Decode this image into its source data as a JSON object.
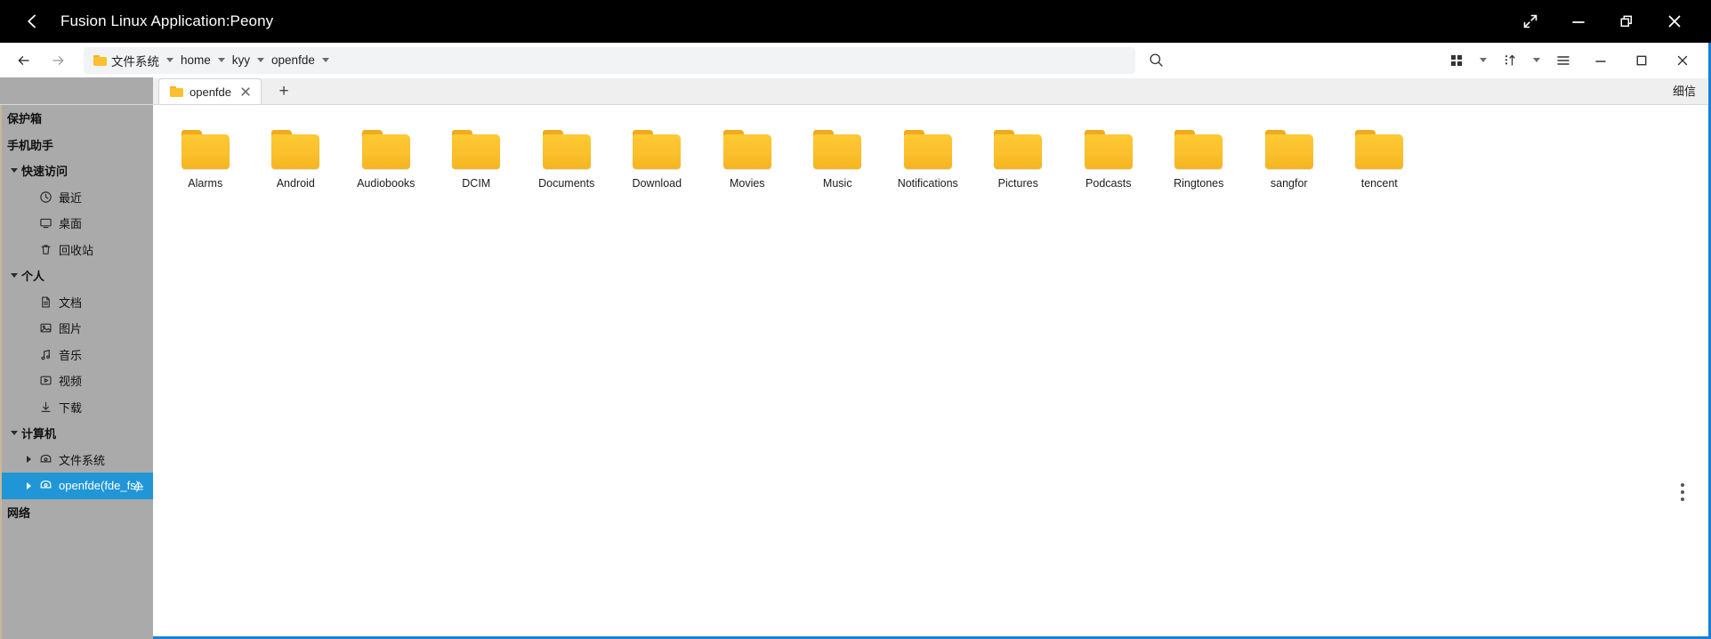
{
  "titlebar": {
    "back_icon": "chevron-left-icon",
    "title": "Fusion Linux Application:Peony",
    "controls": [
      {
        "name": "expand-button",
        "icon": "expand-arrows-icon"
      },
      {
        "name": "minimize-button",
        "icon": "minimize-icon"
      },
      {
        "name": "restore-button",
        "icon": "restore-windows-icon"
      },
      {
        "name": "close-button",
        "icon": "close-x-icon"
      }
    ]
  },
  "toolbar": {
    "back_icon": "arrow-left-icon",
    "forward_icon": "arrow-right-icon",
    "breadcrumbs": [
      {
        "label": "文件系统",
        "has_folder_icon": true
      },
      {
        "label": "home",
        "has_folder_icon": false
      },
      {
        "label": "kyy",
        "has_folder_icon": false
      },
      {
        "label": "openfde",
        "has_folder_icon": false
      }
    ],
    "search_icon": "search-icon",
    "view_icon": "grid-view-icon",
    "sort_icon": "sort-ascending-icon",
    "menu_icon": "hamburger-menu-icon",
    "window_minimize_icon": "minimize-icon",
    "window_maximize_icon": "maximize-icon",
    "window_close_icon": "close-x-icon"
  },
  "tabs": {
    "items": [
      {
        "label": "openfde",
        "close_icon": "close-x-icon",
        "active": true
      }
    ],
    "new_tab_label": "+",
    "right_label": "细信"
  },
  "sidebar": {
    "rows": [
      {
        "label": "保护箱",
        "indent": "ind-sec",
        "bold": true,
        "twisty": "none",
        "icon": "none",
        "selected": false
      },
      {
        "label": "手机助手",
        "indent": "ind-sec",
        "bold": true,
        "twisty": "none",
        "icon": "none",
        "selected": false
      },
      {
        "label": "快速访问",
        "indent": "ind-sec",
        "bold": true,
        "twisty": "down",
        "icon": "none",
        "selected": false
      },
      {
        "label": "最近",
        "indent": "ind-1",
        "bold": false,
        "twisty": "none",
        "icon": "clock-icon",
        "selected": false
      },
      {
        "label": "桌面",
        "indent": "ind-1",
        "bold": false,
        "twisty": "none",
        "icon": "monitor-icon",
        "selected": false
      },
      {
        "label": "回收站",
        "indent": "ind-1",
        "bold": false,
        "twisty": "none",
        "icon": "trash-icon",
        "selected": false
      },
      {
        "label": "个人",
        "indent": "ind-sec",
        "bold": true,
        "twisty": "down",
        "icon": "none",
        "selected": false
      },
      {
        "label": "文档",
        "indent": "ind-1",
        "bold": false,
        "twisty": "none",
        "icon": "document-icon",
        "selected": false
      },
      {
        "label": "图片",
        "indent": "ind-1",
        "bold": false,
        "twisty": "none",
        "icon": "image-icon",
        "selected": false
      },
      {
        "label": "音乐",
        "indent": "ind-1",
        "bold": false,
        "twisty": "none",
        "icon": "music-note-icon",
        "selected": false
      },
      {
        "label": "视频",
        "indent": "ind-1",
        "bold": false,
        "twisty": "none",
        "icon": "video-icon",
        "selected": false
      },
      {
        "label": "下载",
        "indent": "ind-1",
        "bold": false,
        "twisty": "none",
        "icon": "download-icon",
        "selected": false
      },
      {
        "label": "计算机",
        "indent": "ind-sec",
        "bold": true,
        "twisty": "down",
        "icon": "none",
        "selected": false
      },
      {
        "label": "文件系统",
        "indent": "ind-comp",
        "bold": false,
        "twisty": "right",
        "icon": "drive-icon",
        "selected": false
      },
      {
        "label": "openfde(fde_fs)",
        "indent": "ind-comp",
        "bold": false,
        "twisty": "right",
        "icon": "drive-icon",
        "selected": true,
        "eject_icon": "eject-icon"
      },
      {
        "label": "网络",
        "indent": "ind-sec",
        "bold": true,
        "twisty": "none",
        "icon": "none",
        "selected": false
      }
    ],
    "selected_color": "#2196d6"
  },
  "files": {
    "items": [
      {
        "name": "Alarms",
        "type": "folder"
      },
      {
        "name": "Android",
        "type": "folder"
      },
      {
        "name": "Audiobooks",
        "type": "folder"
      },
      {
        "name": "DCIM",
        "type": "folder"
      },
      {
        "name": "Documents",
        "type": "folder"
      },
      {
        "name": "Download",
        "type": "folder"
      },
      {
        "name": "Movies",
        "type": "folder"
      },
      {
        "name": "Music",
        "type": "folder"
      },
      {
        "name": "Notifications",
        "type": "folder"
      },
      {
        "name": "Pictures",
        "type": "folder"
      },
      {
        "name": "Podcasts",
        "type": "folder"
      },
      {
        "name": "Ringtones",
        "type": "folder"
      },
      {
        "name": "sangfor",
        "type": "folder"
      },
      {
        "name": "tencent",
        "type": "folder"
      }
    ],
    "folder_color": "#fbc02d",
    "overflow_icon": "more-vertical-icon"
  }
}
